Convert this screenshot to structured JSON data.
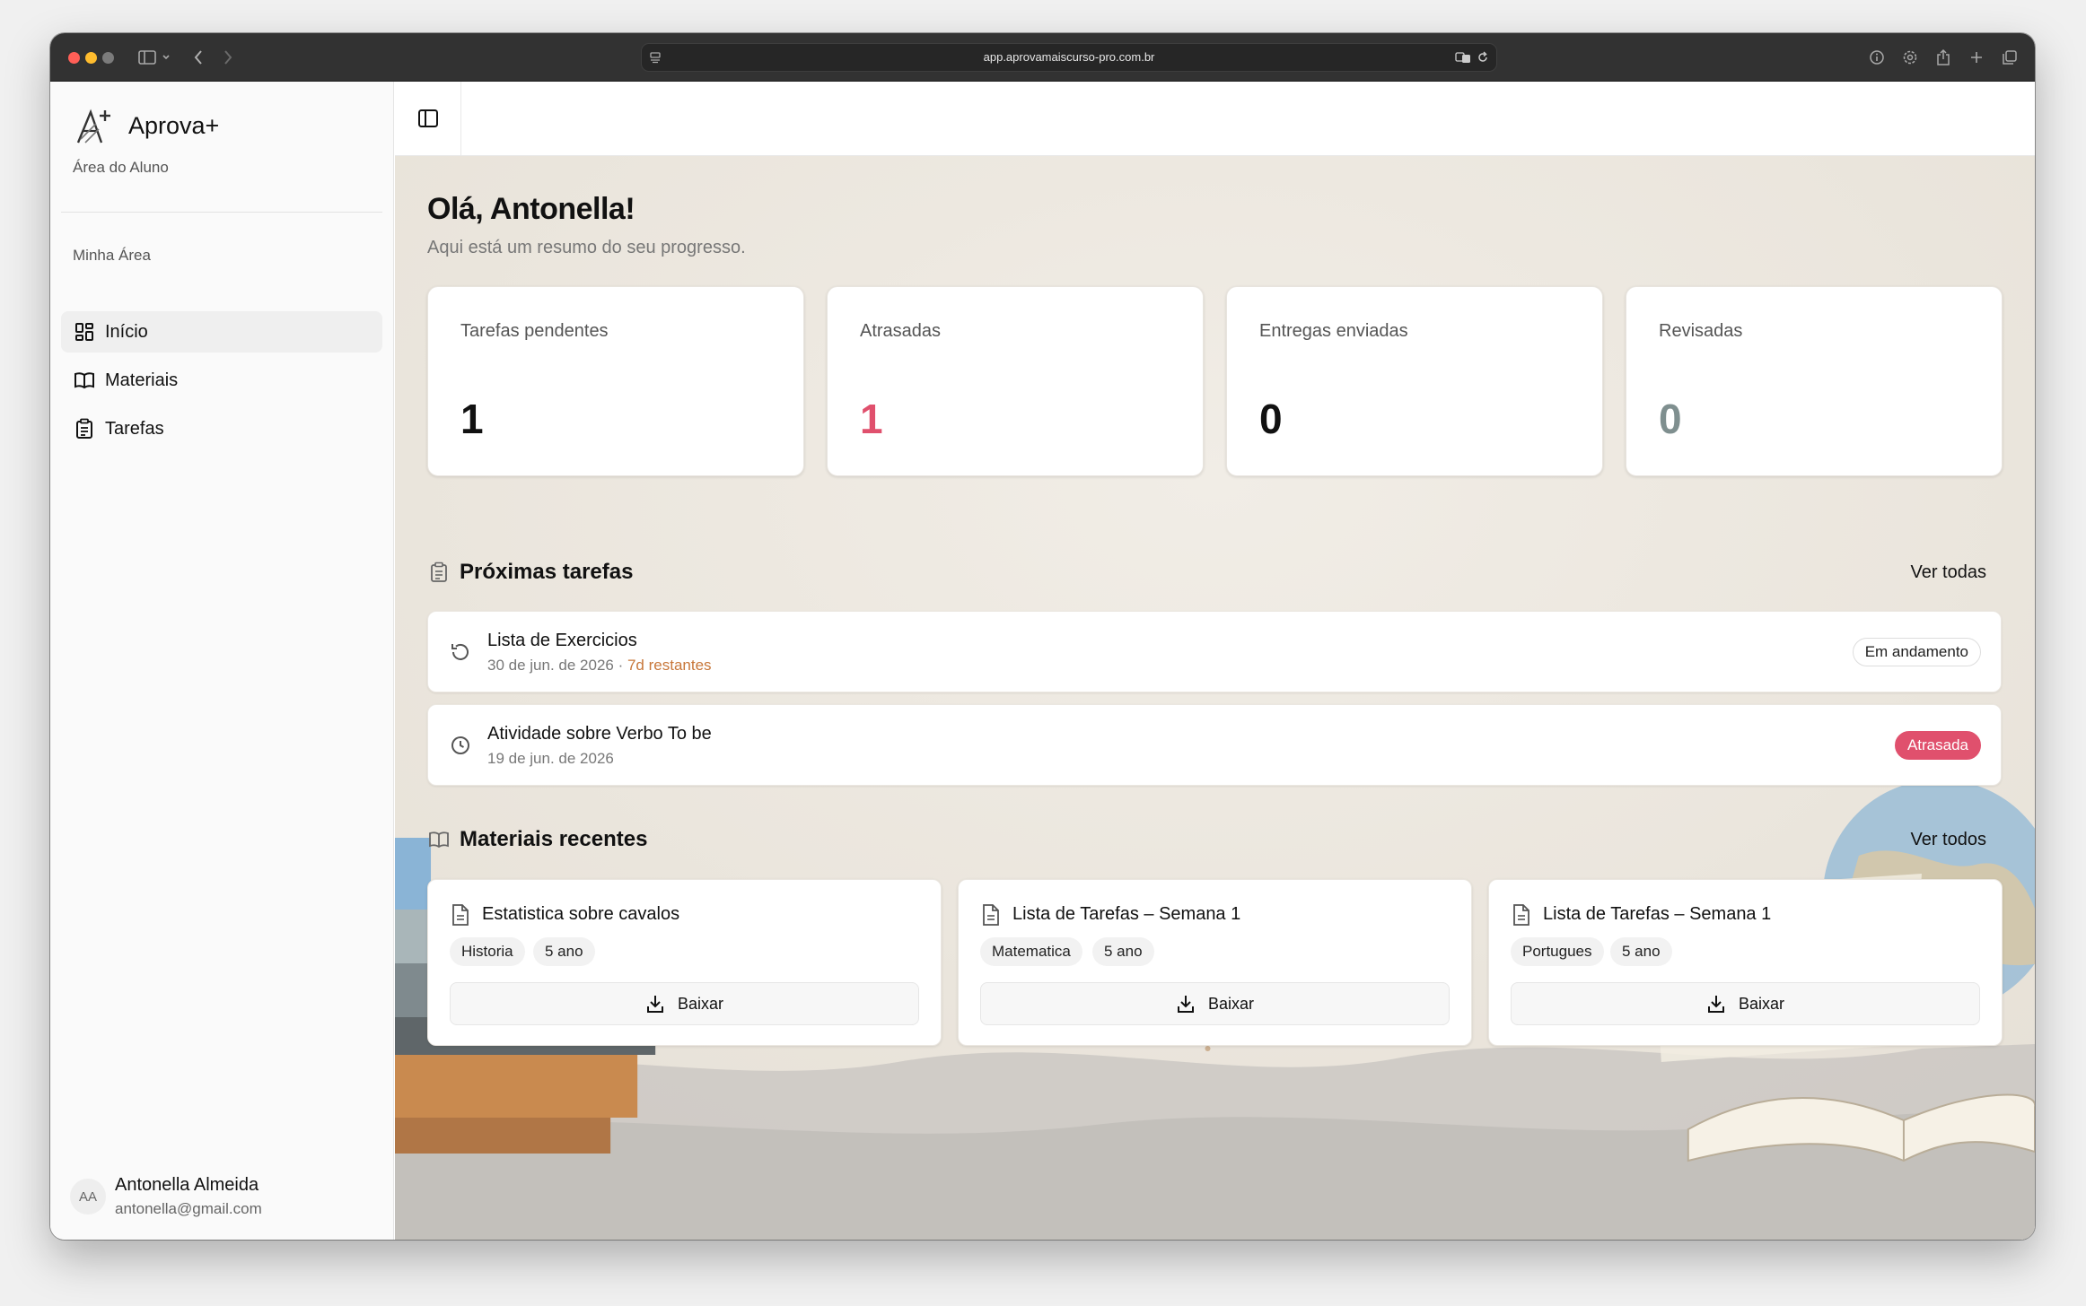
{
  "browser": {
    "url": "app.aprovamaiscurso-pro.com.br"
  },
  "sidebar": {
    "brand": "Aprova+",
    "subtitle": "Área do Aluno",
    "group_label": "Minha Área",
    "items": [
      {
        "label": "Início",
        "icon": "dashboard-icon",
        "active": true
      },
      {
        "label": "Materiais",
        "icon": "book-icon",
        "active": false
      },
      {
        "label": "Tarefas",
        "icon": "clipboard-icon",
        "active": false
      }
    ],
    "user": {
      "initials": "AA",
      "name": "Antonella Almeida",
      "email": "antonella@gmail.com"
    }
  },
  "main": {
    "greeting": "Olá, Antonella!",
    "subtitle": "Aqui está um resumo do seu progresso.",
    "stats": [
      {
        "label": "Tarefas pendentes",
        "value": "1",
        "color": "#111111"
      },
      {
        "label": "Atrasadas",
        "value": "1",
        "color": "#e0506d"
      },
      {
        "label": "Entregas enviadas",
        "value": "0",
        "color": "#111111"
      },
      {
        "label": "Revisadas",
        "value": "0",
        "color": "#7f8f8f"
      }
    ],
    "tasks_section": {
      "title": "Próximas tarefas",
      "see_all": "Ver todas",
      "items": [
        {
          "title": "Lista de Exercicios",
          "date": "30 de jun. de 2026",
          "separator": " · ",
          "remaining": "7d restantes",
          "status": "Em andamento",
          "icon": "history-icon"
        },
        {
          "title": "Atividade sobre Verbo To be",
          "date": "19 de jun. de 2026",
          "status": "Atrasada",
          "icon": "clock-icon"
        }
      ]
    },
    "materials_section": {
      "title": "Materiais recentes",
      "see_all": "Ver todos",
      "download_label": "Baixar",
      "items": [
        {
          "title": "Estatistica sobre cavalos",
          "subject": "Historia",
          "grade": "5 ano"
        },
        {
          "title": "Lista de Tarefas – Semana 1",
          "subject": "Matematica",
          "grade": "5 ano"
        },
        {
          "title": "Lista de Tarefas – Semana 1",
          "subject": "Portugues",
          "grade": "5 ano"
        }
      ]
    }
  },
  "colors": {
    "accent_danger": "#e0506d",
    "remaining_orange": "#c8773a"
  }
}
